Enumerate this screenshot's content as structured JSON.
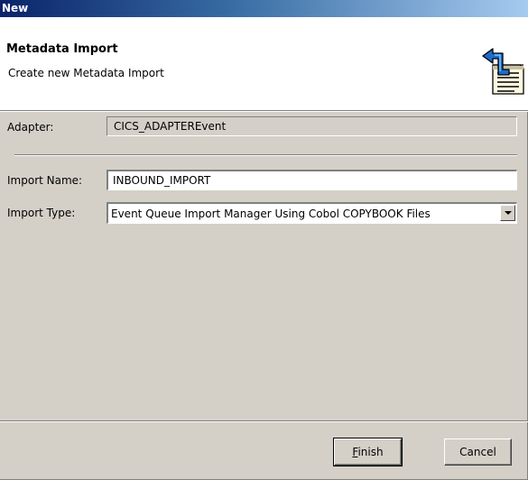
{
  "window": {
    "title": "New"
  },
  "banner": {
    "title": "Metadata Import",
    "description": "Create new Metadata Import",
    "icon": "import-document-icon"
  },
  "form": {
    "adapter_label": "Adapter:",
    "adapter_value": "CICS_ADAPTEREvent",
    "import_name_label": "Import Name:",
    "import_name_value": "INBOUND_IMPORT",
    "import_type_label": "Import Type:",
    "import_type_value": "Event Queue Import Manager Using Cobol COPYBOOK Files"
  },
  "buttons": {
    "finish_mnemonic": "F",
    "finish_rest": "inish",
    "cancel_label": "Cancel"
  },
  "colors": {
    "title_bar_start": "#0a246a",
    "title_bar_end": "#a6caf0",
    "dialog_background": "#d4d0c8",
    "banner_background": "#ffffff"
  }
}
